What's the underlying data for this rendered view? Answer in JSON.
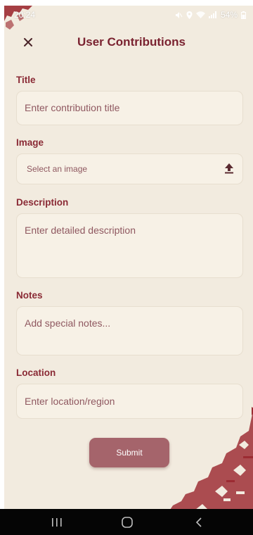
{
  "status": {
    "time": "20:24",
    "battery": "54%"
  },
  "header": {
    "title": "User Contributions",
    "close_icon": "close-icon"
  },
  "form": {
    "title": {
      "label": "Title",
      "placeholder": "Enter contribution title"
    },
    "image": {
      "label": "Image",
      "placeholder": "Select an image",
      "icon": "upload-icon"
    },
    "description": {
      "label": "Description",
      "placeholder": "Enter detailed description"
    },
    "notes": {
      "label": "Notes",
      "placeholder": "Add special notes..."
    },
    "location": {
      "label": "Location",
      "placeholder": "Enter location/region"
    },
    "submit_label": "Submit"
  },
  "colors": {
    "accent": "#7a2230",
    "button": "#a5646b",
    "background": "#f2ebdf",
    "field": "#f7f1e6"
  }
}
